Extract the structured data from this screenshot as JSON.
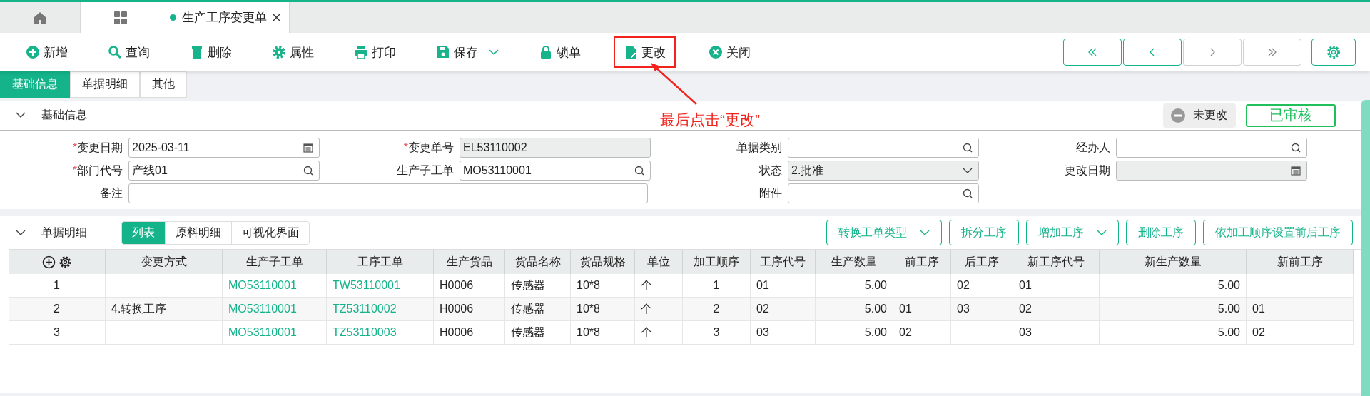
{
  "doc_tabs": [
    {
      "kind": "home"
    },
    {
      "kind": "grid"
    },
    {
      "kind": "doc",
      "label": "生产工序变更单"
    }
  ],
  "toolbar": [
    {
      "kind": "add",
      "label": "新增",
      "dropdown": false,
      "highlighted": false
    },
    {
      "kind": "search",
      "label": "查询",
      "dropdown": false,
      "highlighted": false
    },
    {
      "kind": "delete",
      "label": "删除",
      "dropdown": false,
      "highlighted": false
    },
    {
      "kind": "settings",
      "label": "属性",
      "dropdown": false,
      "highlighted": false
    },
    {
      "kind": "print",
      "label": "打印",
      "dropdown": false,
      "highlighted": false
    },
    {
      "kind": "save",
      "label": "保存",
      "dropdown": true,
      "highlighted": false
    },
    {
      "kind": "lock",
      "label": "锁单",
      "dropdown": false,
      "highlighted": false
    },
    {
      "kind": "edit",
      "label": "更改",
      "dropdown": false,
      "highlighted": true
    },
    {
      "kind": "close",
      "label": "关闭",
      "dropdown": false,
      "highlighted": false
    }
  ],
  "nav_buttons": [
    {
      "kind": "first",
      "disabled": false
    },
    {
      "kind": "prev",
      "disabled": false
    },
    {
      "kind": "next",
      "disabled": true
    },
    {
      "kind": "last",
      "disabled": true
    }
  ],
  "form_tabs": [
    {
      "label": "基础信息",
      "selected": true
    },
    {
      "label": "单据明细",
      "selected": false
    },
    {
      "label": "其他",
      "selected": false
    }
  ],
  "basic_section": {
    "title": "基础信息",
    "expanded": true,
    "change_badge": "未更改",
    "status_stamp": "已审核",
    "annotation": "最后点击“更改”",
    "fields": [
      {
        "label": "变更日期",
        "required_mark": "*",
        "kind": "date",
        "value": "2025-03-11",
        "disabled": false
      },
      {
        "label": "变更单号",
        "required_mark": "*",
        "kind": "text",
        "value": "EL53110002",
        "disabled": true
      },
      {
        "label": "单据类别",
        "kind": "lookup",
        "disabled": false
      },
      {
        "label": "经办人",
        "kind": "lookup",
        "disabled": false
      },
      {
        "label": "部门代号",
        "required_mark": "*",
        "kind": "lookup",
        "value": "产线01",
        "disabled": false
      },
      {
        "label": "生产子工单",
        "kind": "lookup",
        "value": "MO53110001",
        "disabled": false
      },
      {
        "label": "状态",
        "kind": "select",
        "value": "2.批准",
        "disabled": true
      },
      {
        "label": "更改日期",
        "kind": "date",
        "disabled": true
      },
      {
        "label": "备注",
        "kind": "wide",
        "disabled": false
      },
      {
        "label": "附件",
        "kind": "lookup",
        "disabled": false
      }
    ]
  },
  "detail_section": {
    "title": "单据明细",
    "expanded": true,
    "view_tabs": [
      {
        "label": "列表",
        "selected": true
      },
      {
        "label": "原料明细",
        "selected": false
      },
      {
        "label": "可视化界面",
        "selected": false
      }
    ],
    "actions": [
      {
        "label": "转换工单类型",
        "dropdown": true
      },
      {
        "label": "拆分工序",
        "dropdown": false
      },
      {
        "label": "增加工序",
        "dropdown": true
      },
      {
        "label": "删除工序",
        "dropdown": false
      },
      {
        "label": "依加工顺序设置前后工序",
        "dropdown": false
      }
    ]
  },
  "table": {
    "columns": [
      {
        "label": "变更方式",
        "kind": "text"
      },
      {
        "label": "生产子工单",
        "kind": "link"
      },
      {
        "label": "工序工单",
        "kind": "link"
      },
      {
        "label": "生产货品",
        "kind": "text"
      },
      {
        "label": "货品名称",
        "kind": "text"
      },
      {
        "label": "货品规格",
        "kind": "text"
      },
      {
        "label": "单位",
        "kind": "text"
      },
      {
        "label": "加工顺序",
        "kind": "center"
      },
      {
        "label": "工序代号",
        "kind": "text"
      },
      {
        "label": "生产数量",
        "kind": "number"
      },
      {
        "label": "前工序",
        "kind": "text"
      },
      {
        "label": "后工序",
        "kind": "text"
      },
      {
        "label": "新工序代号",
        "kind": "text"
      },
      {
        "label": "新生产数量",
        "kind": "number"
      },
      {
        "label": "新前工序",
        "kind": "text"
      }
    ],
    "rows": [
      {
        "no": "1",
        "cells": [
          "",
          "MO53110001",
          "TW53110001",
          "H0006",
          "传感器",
          "10*8",
          "个",
          "1",
          "01",
          "5.00",
          "",
          "02",
          "01",
          "5.00",
          ""
        ]
      },
      {
        "no": "2",
        "cells": [
          "4.转换工序",
          "MO53110001",
          "TZ53110002",
          "H0006",
          "传感器",
          "10*8",
          "个",
          "2",
          "02",
          "5.00",
          "01",
          "03",
          "02",
          "5.00",
          "01"
        ]
      },
      {
        "no": "3",
        "cells": [
          "",
          "MO53110001",
          "TZ53110003",
          "H0006",
          "传感器",
          "10*8",
          "个",
          "3",
          "03",
          "5.00",
          "02",
          "",
          "03",
          "5.00",
          "02"
        ]
      }
    ]
  }
}
